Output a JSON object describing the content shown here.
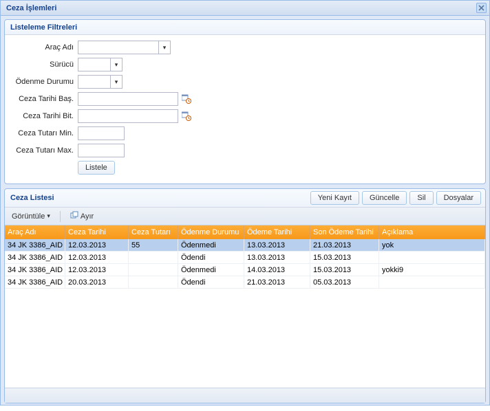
{
  "window": {
    "title": "Ceza İşlemleri"
  },
  "filters": {
    "title": "Listeleme Filtreleri",
    "arac_label": "Araç Adı",
    "surucu_label": "Sürücü",
    "odenme_label": "Ödenme Durumu",
    "ceza_bas_label": "Ceza Tarihi Baş.",
    "ceza_bit_label": "Ceza Tarihi Bit.",
    "tutar_min_label": "Ceza Tutarı Min.",
    "tutar_max_label": "Ceza Tutarı Max.",
    "listele_btn": "Listele",
    "arac_value": "",
    "surucu_value": "",
    "odenme_value": "",
    "ceza_bas_value": "",
    "ceza_bit_value": "",
    "tutar_min_value": "",
    "tutar_max_value": ""
  },
  "list": {
    "title": "Ceza Listesi",
    "btn_new": "Yeni Kayıt",
    "btn_update": "Güncelle",
    "btn_delete": "Sil",
    "btn_files": "Dosyalar",
    "toolbar_view": "Görüntüle",
    "toolbar_detach": "Ayır",
    "columns": {
      "arac": "Araç Adı",
      "ceza_tarihi": "Ceza Tarihi",
      "ceza_tutari": "Ceza Tutarı",
      "odenme_durumu": "Ödenme Durumu",
      "odeme_tarihi": "Ödeme Tarihi",
      "son_odeme": "Son Ödeme Tarihi",
      "aciklama": "Açıklama"
    },
    "rows": [
      {
        "arac": "34 JK 3386_AID",
        "ceza_tarihi": "12.03.2013",
        "ceza_tutari": "55",
        "odenme_durumu": "Ödenmedi",
        "odeme_tarihi": "13.03.2013",
        "son_odeme": "21.03.2013",
        "aciklama": "yok",
        "selected": true
      },
      {
        "arac": "34 JK 3386_AID",
        "ceza_tarihi": "12.03.2013",
        "ceza_tutari": "",
        "odenme_durumu": "Ödendi",
        "odeme_tarihi": "13.03.2013",
        "son_odeme": "15.03.2013",
        "aciklama": "",
        "selected": false
      },
      {
        "arac": "34 JK 3386_AID",
        "ceza_tarihi": "12.03.2013",
        "ceza_tutari": "",
        "odenme_durumu": "Ödenmedi",
        "odeme_tarihi": "14.03.2013",
        "son_odeme": "15.03.2013",
        "aciklama": "yokki9",
        "selected": false
      },
      {
        "arac": "34 JK 3386_AID",
        "ceza_tarihi": "20.03.2013",
        "ceza_tutari": "",
        "odenme_durumu": "Ödendi",
        "odeme_tarihi": "21.03.2013",
        "son_odeme": "05.03.2013",
        "aciklama": "",
        "selected": false
      }
    ]
  }
}
